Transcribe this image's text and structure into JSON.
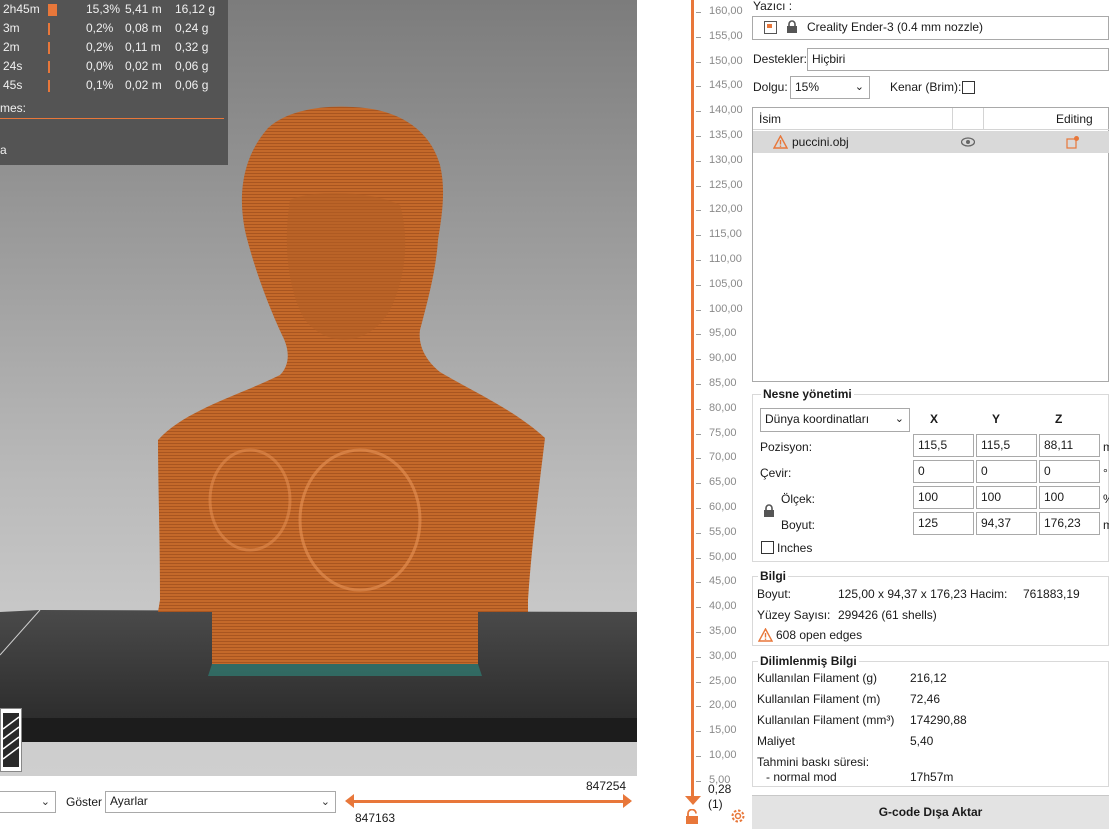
{
  "stats": {
    "rows": [
      {
        "time": "2h45m",
        "percent": "15,3%",
        "length": "5,41 m",
        "weight": "16,12 g",
        "swatch": "wide"
      },
      {
        "time": "3m",
        "percent": "0,2%",
        "length": "0,08 m",
        "weight": "0,24 g",
        "swatch": "thin"
      },
      {
        "time": "2m",
        "percent": "0,2%",
        "length": "0,11 m",
        "weight": "0,32 g",
        "swatch": "thin"
      },
      {
        "time": "24s",
        "percent": "0,0%",
        "length": "0,02 m",
        "weight": "0,06 g",
        "swatch": "thin"
      },
      {
        "time": "45s",
        "percent": "0,1%",
        "length": "0,02 m",
        "weight": "0,06 g",
        "swatch": "thin"
      }
    ],
    "footer_label": "mes:",
    "footer_2": "a"
  },
  "bottom": {
    "view_combo_value": "",
    "goster_label": "Göster",
    "goster_value": "Ayarlar",
    "h_slider_max": "847254",
    "h_slider_min": "847163"
  },
  "layer_slider": {
    "ticks": [
      "160,00",
      "155,00",
      "150,00",
      "145,00",
      "140,00",
      "135,00",
      "130,00",
      "125,00",
      "120,00",
      "115,00",
      "110,00",
      "105,00",
      "100,00",
      "95,00",
      "90,00",
      "85,00",
      "80,00",
      "75,00",
      "70,00",
      "65,00",
      "60,00",
      "55,00",
      "50,00",
      "45,00",
      "40,00",
      "35,00",
      "30,00",
      "25,00",
      "20,00",
      "15,00",
      "10,00",
      "5,00"
    ],
    "current_height": "0,28",
    "current_layer": "(1)"
  },
  "printer": {
    "label": "Yazıcı :",
    "value": "Creality Ender-3 (0.4 mm nozzle)"
  },
  "supports": {
    "label": "Destekler:",
    "value": "Hiçbiri"
  },
  "infill": {
    "label": "Dolgu:",
    "value": "15%"
  },
  "brim": {
    "label": "Kenar (Brim):",
    "checked": false
  },
  "object_list": {
    "col_name": "İsim",
    "col_editing": "Editing",
    "items": [
      {
        "name": "puccini.obj",
        "warning": true
      }
    ]
  },
  "object_manipulation": {
    "title": "Nesne yönetimi",
    "coord_system": "Dünya koordinatları",
    "axes": [
      "X",
      "Y",
      "Z"
    ],
    "rows": [
      {
        "label": "Pozisyon:",
        "values": [
          "115,5",
          "115,5",
          "88,11"
        ],
        "unit": "m"
      },
      {
        "label": "Çevir:",
        "values": [
          "0",
          "0",
          "0"
        ],
        "unit": "°"
      },
      {
        "label": "Ölçek:",
        "values": [
          "100",
          "100",
          "100"
        ],
        "unit": "%"
      },
      {
        "label": "Boyut:",
        "values": [
          "125",
          "94,37",
          "176,23"
        ],
        "unit": "m"
      }
    ],
    "inches_label": "Inches"
  },
  "info": {
    "title": "Bilgi",
    "size_label": "Boyut:",
    "size_value": "125,00 x 94,37 x 176,23",
    "volume_label": "Hacim:",
    "volume_value": "761883,19",
    "facets_label": "Yüzey Sayısı:",
    "facets_value": "299426 (61 shells)",
    "open_edges": "608 open edges"
  },
  "sliced_info": {
    "title": "Dilimlenmiş Bilgi",
    "rows": [
      {
        "label": "Kullanılan Filament (g)",
        "value": "216,12"
      },
      {
        "label": "Kullanılan Filament (m)",
        "value": "72,46"
      },
      {
        "label": "Kullanılan Filament (mm³)",
        "value": "174290,88"
      },
      {
        "label": "Maliyet",
        "value": "5,40"
      }
    ],
    "time_label": "Tahmini baskı süresi:",
    "mode_label": "- normal mod",
    "mode_value": "17h57m"
  },
  "export_button": "G-code Dışa Aktar",
  "colors": {
    "accent": "#e8773a",
    "model": "#c4692a",
    "warning": "#e8773a"
  }
}
